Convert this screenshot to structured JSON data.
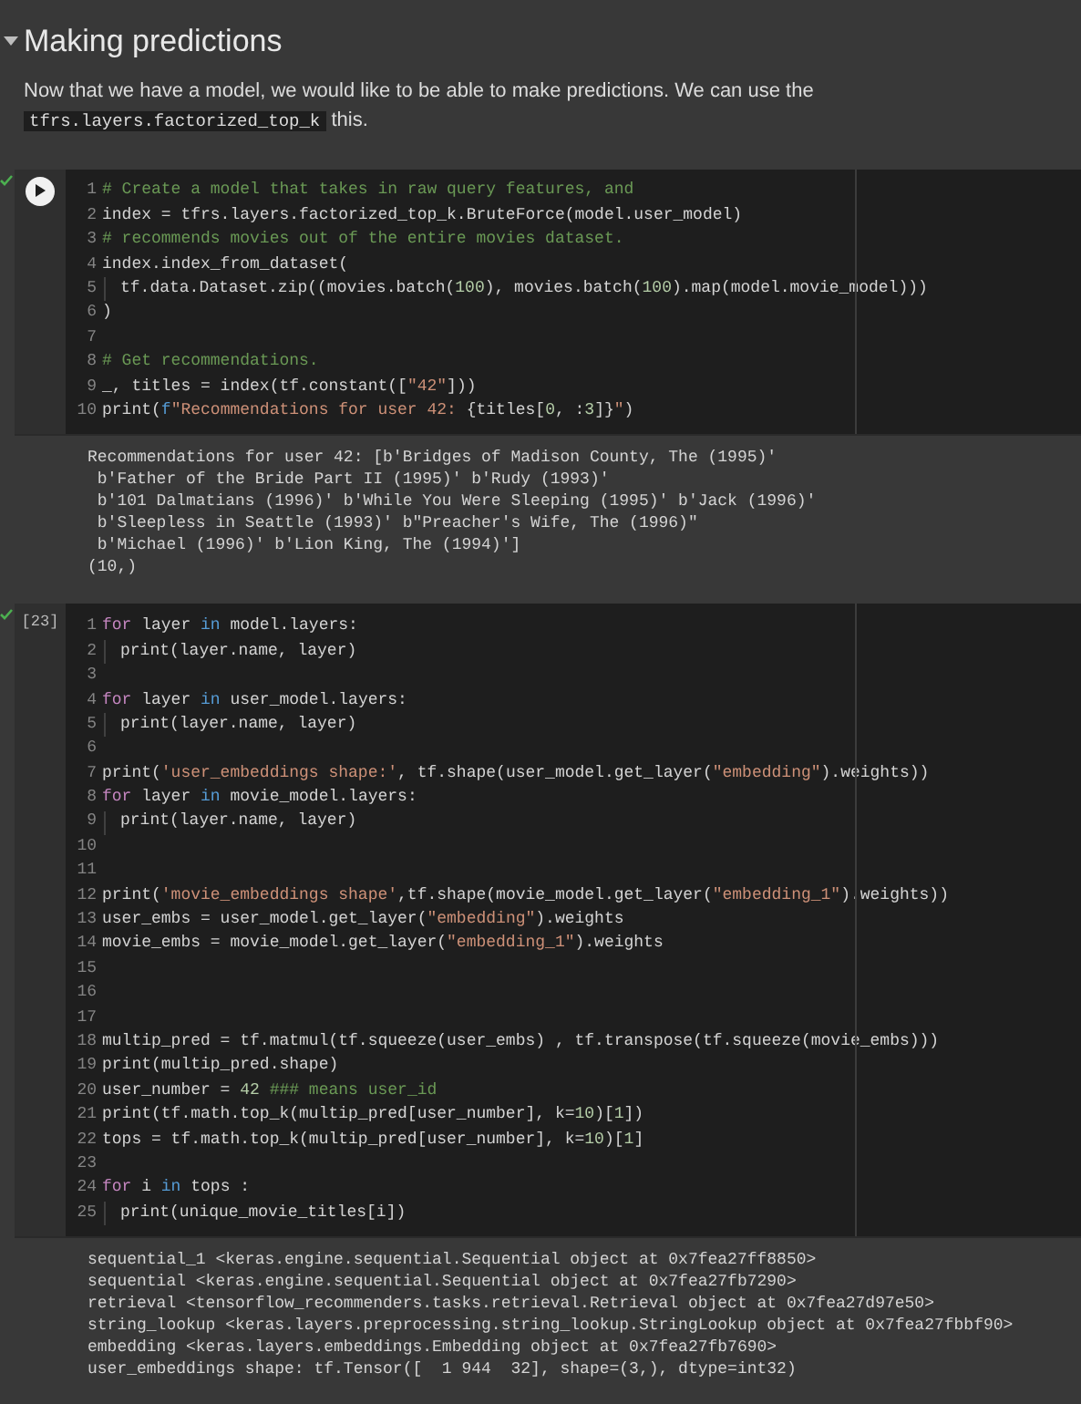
{
  "section": {
    "title": "Making predictions",
    "expanded": true
  },
  "paragraph": {
    "before": "Now that we have a model, we would like to be able to make predictions. We can use the ",
    "code": "tfrs.layers.factorized_top_k",
    "after": "this."
  },
  "cells": [
    {
      "done": true,
      "run_button": true,
      "lines": [
        {
          "number": "1",
          "indented": false,
          "tokens": [
            {
              "text": "# Create a model that takes in raw query features, and",
              "kind": "comment"
            }
          ]
        },
        {
          "number": "2",
          "indented": false,
          "tokens": [
            {
              "text": "index = tfrs.layers.factorized_top_k.BruteForce(model.user_model)",
              "kind": "plain"
            }
          ]
        },
        {
          "number": "3",
          "indented": false,
          "tokens": [
            {
              "text": "# recommends movies out of the entire movies dataset.",
              "kind": "comment"
            }
          ]
        },
        {
          "number": "4",
          "indented": false,
          "tokens": [
            {
              "text": "index.index_from_dataset(",
              "kind": "plain"
            }
          ]
        },
        {
          "number": "5",
          "indented": true,
          "tokens": [
            {
              "text": "tf.data.Dataset.zip((movies.batch(",
              "kind": "plain"
            },
            {
              "text": "100",
              "kind": "number"
            },
            {
              "text": "), movies.batch(",
              "kind": "plain"
            },
            {
              "text": "100",
              "kind": "number"
            },
            {
              "text": ").map(model.movie_model)))",
              "kind": "plain"
            }
          ]
        },
        {
          "number": "6",
          "indented": false,
          "tokens": [
            {
              "text": ")",
              "kind": "plain"
            }
          ]
        },
        {
          "number": "7",
          "indented": false
        },
        {
          "number": "8",
          "indented": false,
          "tokens": [
            {
              "text": "# Get recommendations.",
              "kind": "comment"
            }
          ]
        },
        {
          "number": "9",
          "indented": false,
          "tokens": [
            {
              "text": "_, titles = index(tf.constant([",
              "kind": "plain"
            },
            {
              "text": "\"42\"",
              "kind": "string"
            },
            {
              "text": "]))",
              "kind": "plain"
            }
          ]
        },
        {
          "number": "10",
          "indented": false,
          "tokens": [
            {
              "text": "print(",
              "kind": "plain"
            },
            {
              "text": "f",
              "kind": "storage"
            },
            {
              "text": "\"Recommendations for user 42: ",
              "kind": "string"
            },
            {
              "text": "{titles[",
              "kind": "plain"
            },
            {
              "text": "0",
              "kind": "number"
            },
            {
              "text": ", :",
              "kind": "plain"
            },
            {
              "text": "3",
              "kind": "number"
            },
            {
              "text": "]}",
              "kind": "plain"
            },
            {
              "text": "\"",
              "kind": "string"
            },
            {
              "text": ")",
              "kind": "plain"
            }
          ]
        }
      ],
      "output": [
        "Recommendations for user 42: [b'Bridges of Madison County, The (1995)'",
        " b'Father of the Bride Part II (1995)' b'Rudy (1993)'",
        " b'101 Dalmatians (1996)' b'While You Were Sleeping (1995)' b'Jack (1996)'",
        " b'Sleepless in Seattle (1993)' b\"Preacher's Wife, The (1996)\"",
        " b'Michael (1996)' b'Lion King, The (1994)']",
        "(10,)"
      ]
    },
    {
      "done": true,
      "run_button": false,
      "execution_count": "[23]",
      "lines": [
        {
          "number": "1",
          "indented": false,
          "tokens": [
            {
              "text": "for",
              "kind": "control"
            },
            {
              "text": " layer ",
              "kind": "plain"
            },
            {
              "text": "in",
              "kind": "storage"
            },
            {
              "text": " model.layers:",
              "kind": "plain"
            }
          ]
        },
        {
          "number": "2",
          "indented": true,
          "tokens": [
            {
              "text": "print(layer.name, layer)",
              "kind": "plain"
            }
          ]
        },
        {
          "number": "3",
          "indented": false
        },
        {
          "number": "4",
          "indented": false,
          "tokens": [
            {
              "text": "for",
              "kind": "control"
            },
            {
              "text": " layer ",
              "kind": "plain"
            },
            {
              "text": "in",
              "kind": "storage"
            },
            {
              "text": " user_model.layers:",
              "kind": "plain"
            }
          ]
        },
        {
          "number": "5",
          "indented": true,
          "tokens": [
            {
              "text": "print(layer.name, layer)",
              "kind": "plain"
            }
          ]
        },
        {
          "number": "6",
          "indented": false
        },
        {
          "number": "7",
          "indented": false,
          "tokens": [
            {
              "text": "print(",
              "kind": "plain"
            },
            {
              "text": "'user_embeddings shape:'",
              "kind": "string"
            },
            {
              "text": ", tf.shape(user_model.get_layer(",
              "kind": "plain"
            },
            {
              "text": "\"embedding\"",
              "kind": "string"
            },
            {
              "text": ").weights))",
              "kind": "plain"
            }
          ]
        },
        {
          "number": "8",
          "indented": false,
          "tokens": [
            {
              "text": "for",
              "kind": "control"
            },
            {
              "text": " layer ",
              "kind": "plain"
            },
            {
              "text": "in",
              "kind": "storage"
            },
            {
              "text": " movie_model.layers:",
              "kind": "plain"
            }
          ]
        },
        {
          "number": "9",
          "indented": true,
          "tokens": [
            {
              "text": "print(layer.name, layer)",
              "kind": "plain"
            }
          ]
        },
        {
          "number": "10",
          "indented": false
        },
        {
          "number": "11",
          "indented": false
        },
        {
          "number": "12",
          "indented": false,
          "tokens": [
            {
              "text": "print(",
              "kind": "plain"
            },
            {
              "text": "'movie_embeddings shape'",
              "kind": "string"
            },
            {
              "text": ",tf.shape(movie_model.get_layer(",
              "kind": "plain"
            },
            {
              "text": "\"embedding_1\"",
              "kind": "string"
            },
            {
              "text": ").weights))",
              "kind": "plain"
            }
          ]
        },
        {
          "number": "13",
          "indented": false,
          "tokens": [
            {
              "text": "user_embs = user_model.get_layer(",
              "kind": "plain"
            },
            {
              "text": "\"embedding\"",
              "kind": "string"
            },
            {
              "text": ").weights",
              "kind": "plain"
            }
          ]
        },
        {
          "number": "14",
          "indented": false,
          "tokens": [
            {
              "text": "movie_embs = movie_model.get_layer(",
              "kind": "plain"
            },
            {
              "text": "\"embedding_1\"",
              "kind": "string"
            },
            {
              "text": ").weights",
              "kind": "plain"
            }
          ]
        },
        {
          "number": "15",
          "indented": false
        },
        {
          "number": "16",
          "indented": false
        },
        {
          "number": "17",
          "indented": false
        },
        {
          "number": "18",
          "indented": false,
          "tokens": [
            {
              "text": "multip_pred = tf.matmul(tf.squeeze(user_embs) , tf.transpose(tf.squeeze(movie_embs)))",
              "kind": "plain"
            }
          ]
        },
        {
          "number": "19",
          "indented": false,
          "tokens": [
            {
              "text": "print(multip_pred.shape)",
              "kind": "plain"
            }
          ]
        },
        {
          "number": "20",
          "indented": false,
          "tokens": [
            {
              "text": "user_number = ",
              "kind": "plain"
            },
            {
              "text": "42 ",
              "kind": "number"
            },
            {
              "text": "### means user_id",
              "kind": "comment"
            }
          ]
        },
        {
          "number": "21",
          "indented": false,
          "tokens": [
            {
              "text": "print(tf.math.top_k(multip_pred[user_number], k=",
              "kind": "plain"
            },
            {
              "text": "10",
              "kind": "number"
            },
            {
              "text": ")[",
              "kind": "plain"
            },
            {
              "text": "1",
              "kind": "number"
            },
            {
              "text": "])",
              "kind": "plain"
            }
          ]
        },
        {
          "number": "22",
          "indented": false,
          "tokens": [
            {
              "text": "tops = tf.math.top_k(multip_pred[user_number], k=",
              "kind": "plain"
            },
            {
              "text": "10",
              "kind": "number"
            },
            {
              "text": ")[",
              "kind": "plain"
            },
            {
              "text": "1",
              "kind": "number"
            },
            {
              "text": "]",
              "kind": "plain"
            }
          ]
        },
        {
          "number": "23",
          "indented": false
        },
        {
          "number": "24",
          "indented": false,
          "tokens": [
            {
              "text": "for",
              "kind": "control"
            },
            {
              "text": " i ",
              "kind": "plain"
            },
            {
              "text": "in",
              "kind": "storage"
            },
            {
              "text": " tops :",
              "kind": "plain"
            }
          ]
        },
        {
          "number": "25",
          "indented": true,
          "tokens": [
            {
              "text": "print(unique_movie_titles[i])",
              "kind": "plain"
            }
          ]
        }
      ],
      "output": [
        "sequential_1 <keras.engine.sequential.Sequential object at 0x7fea27ff8850>",
        "sequential <keras.engine.sequential.Sequential object at 0x7fea27fb7290>",
        "retrieval <tensorflow_recommenders.tasks.retrieval.Retrieval object at 0x7fea27d97e50>",
        "string_lookup <keras.layers.preprocessing.string_lookup.StringLookup object at 0x7fea27fbbf90>",
        "embedding <keras.layers.embeddings.Embedding object at 0x7fea27fb7690>",
        "user_embeddings shape: tf.Tensor([  1 944  32], shape=(3,), dtype=int32)"
      ]
    }
  ]
}
